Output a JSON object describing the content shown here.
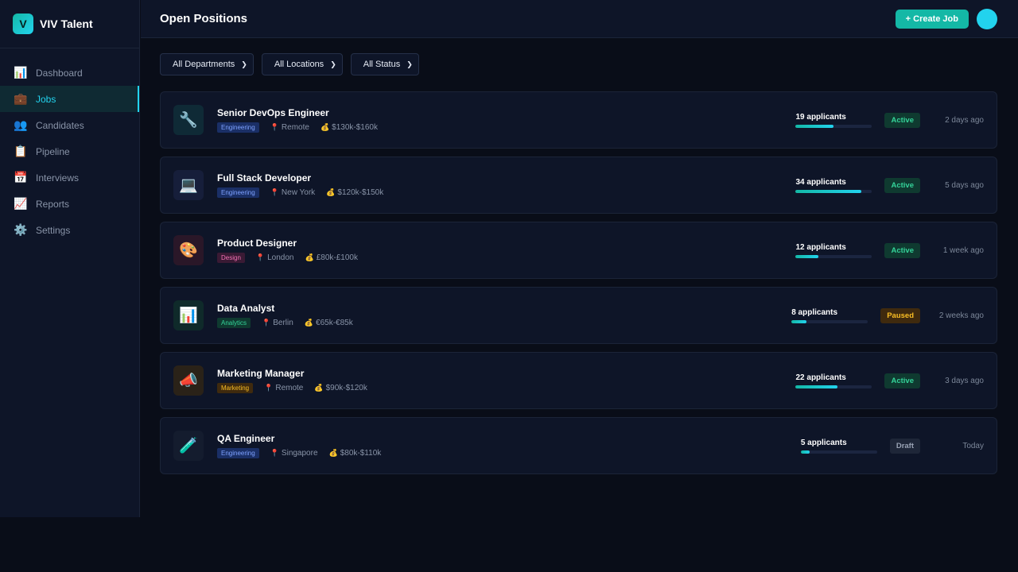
{
  "brand": {
    "logo_letter": "V",
    "name": "VIV Talent"
  },
  "sidebar": {
    "items": [
      {
        "label": "Dashboard",
        "icon": "📊",
        "active": false
      },
      {
        "label": "Jobs",
        "icon": "💼",
        "active": true
      },
      {
        "label": "Candidates",
        "icon": "👥",
        "active": false
      },
      {
        "label": "Pipeline",
        "icon": "📋",
        "active": false
      },
      {
        "label": "Interviews",
        "icon": "📅",
        "active": false
      },
      {
        "label": "Reports",
        "icon": "📈",
        "active": false
      },
      {
        "label": "Settings",
        "icon": "⚙️",
        "active": false
      }
    ]
  },
  "header": {
    "title": "Open Positions",
    "create_label": "+ Create Job"
  },
  "filters": [
    {
      "selected": "All Departments"
    },
    {
      "selected": "All Locations"
    },
    {
      "selected": "All Status"
    }
  ],
  "colors": {
    "accent": "#22d3ee",
    "primary_button": "#14b8a6",
    "background": "#090d18",
    "panel": "#0e1528"
  },
  "jobs": [
    {
      "title": "Senior DevOps Engineer",
      "icon": "🔧",
      "icon_bg": "#0f2a36",
      "department": "Engineering",
      "tag_class": "tag-eng",
      "location": "Remote",
      "salary": "$130k-$160k",
      "applicants": "19 applicants",
      "applicant_fill_pct": 49,
      "status": "Active",
      "status_class": "status-active",
      "posted": "2 days ago"
    },
    {
      "title": "Full Stack Developer",
      "icon": "💻",
      "icon_bg": "#161e3a",
      "department": "Engineering",
      "tag_class": "tag-eng",
      "location": "New York",
      "salary": "$120k-$150k",
      "applicants": "34 applicants",
      "applicant_fill_pct": 86,
      "status": "Active",
      "status_class": "status-active",
      "posted": "5 days ago"
    },
    {
      "title": "Product Designer",
      "icon": "🎨",
      "icon_bg": "#2a1728",
      "department": "Design",
      "tag_class": "tag-design",
      "location": "London",
      "salary": "£80k-£100k",
      "applicants": "12 applicants",
      "applicant_fill_pct": 30,
      "status": "Active",
      "status_class": "status-active",
      "posted": "1 week ago"
    },
    {
      "title": "Data Analyst",
      "icon": "📊",
      "icon_bg": "#0f2a2a",
      "department": "Analytics",
      "tag_class": "tag-analytics",
      "location": "Berlin",
      "salary": "€65k-€85k",
      "applicants": "8 applicants",
      "applicant_fill_pct": 20,
      "status": "Paused",
      "status_class": "status-paused",
      "posted": "2 weeks ago"
    },
    {
      "title": "Marketing Manager",
      "icon": "📣",
      "icon_bg": "#2a2218",
      "department": "Marketing",
      "tag_class": "tag-marketing",
      "location": "Remote",
      "salary": "$90k-$120k",
      "applicants": "22 applicants",
      "applicant_fill_pct": 55,
      "status": "Active",
      "status_class": "status-active",
      "posted": "3 days ago"
    },
    {
      "title": "QA Engineer",
      "icon": "🧪",
      "icon_bg": "#141c2e",
      "department": "Engineering",
      "tag_class": "tag-eng",
      "location": "Singapore",
      "salary": "$80k-$110k",
      "applicants": "5 applicants",
      "applicant_fill_pct": 12,
      "status": "Draft",
      "status_class": "status-draft",
      "posted": "Today"
    }
  ]
}
